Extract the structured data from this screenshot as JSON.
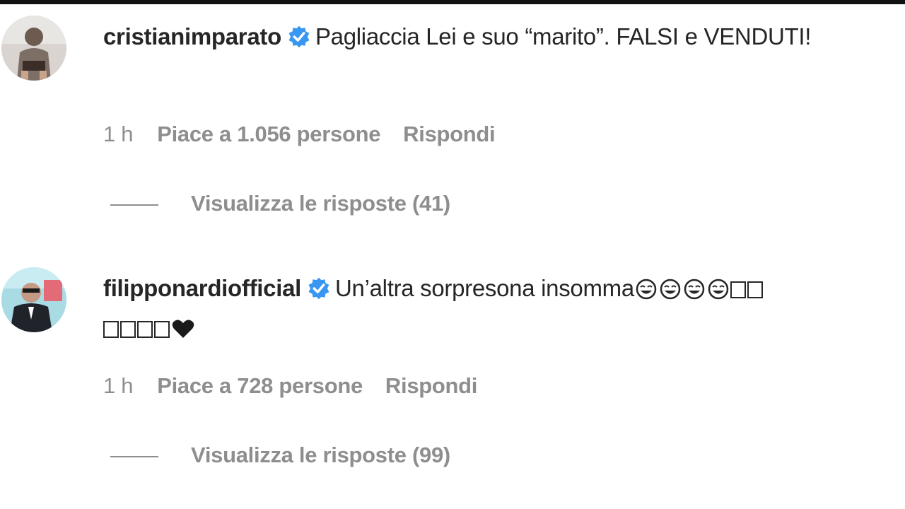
{
  "comments": [
    {
      "username": "cristianimparato",
      "verified": true,
      "text": "Pagliaccia Lei e suo “marito”. FALSI e VENDUTI!",
      "time": "1 h",
      "likes": "Piace a 1.056 persone",
      "reply": "Rispondi",
      "view_replies": "Visualizza le risposte (41)",
      "avatar_icon": "avatar-icon"
    },
    {
      "username": "filipponardiofficial",
      "verified": true,
      "text": "Un’altra sorpresona insomma",
      "time": "1 h",
      "likes": "Piace a 728 persone",
      "reply": "Rispondi",
      "view_replies": "Visualizza le risposte (99)",
      "avatar_icon": "avatar-icon"
    }
  ],
  "colors": {
    "verified_blue": "#3897f0",
    "meta_gray": "#8e8e8e",
    "text": "#262626"
  }
}
